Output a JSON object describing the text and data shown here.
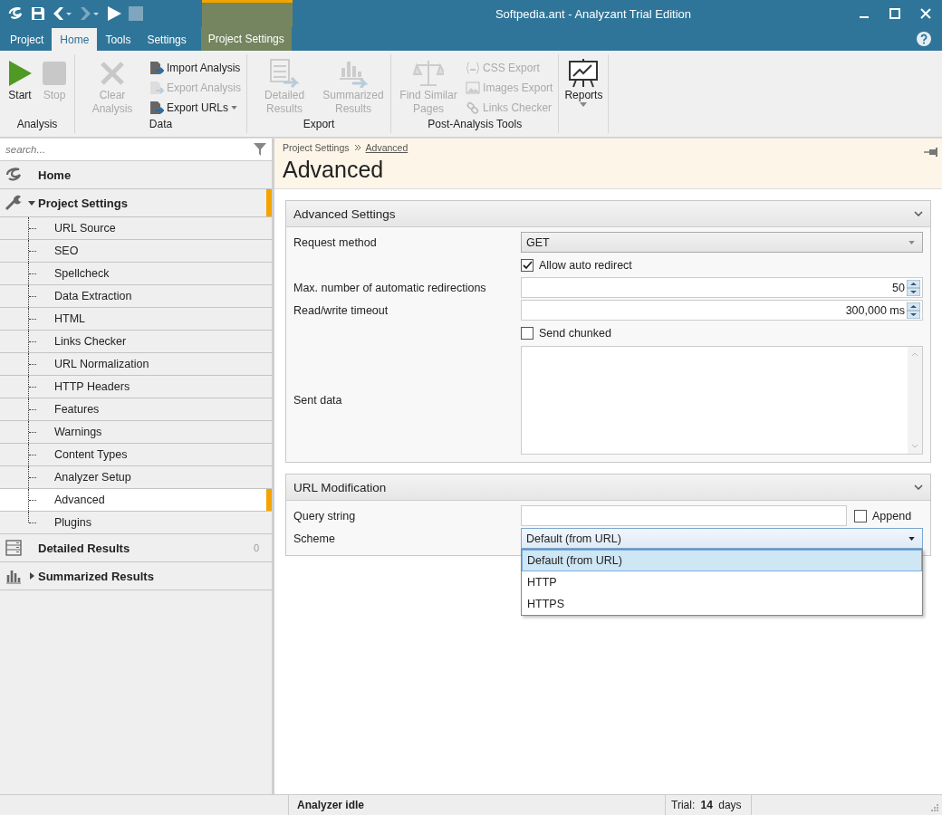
{
  "window": {
    "title": "Softpedia.ant - Analyzant Trial Edition"
  },
  "tabs": [
    {
      "label": "Project",
      "selected": false,
      "kind": "file"
    },
    {
      "label": "Home",
      "selected": true,
      "kind": "normal"
    },
    {
      "label": "Tools",
      "selected": false,
      "kind": "normal"
    },
    {
      "label": "Settings",
      "selected": false,
      "kind": "normal"
    },
    {
      "label": "Project Settings",
      "selected": false,
      "kind": "contextual"
    }
  ],
  "ribbon": {
    "groups": [
      {
        "label": "Analysis",
        "items": [
          {
            "label": "Start",
            "kind": "large",
            "disabled": false
          },
          {
            "label": "Stop",
            "kind": "large",
            "disabled": true
          }
        ]
      },
      {
        "label": "Data",
        "items": [
          {
            "label": "Clear Analysis",
            "kind": "large",
            "disabled": true
          },
          {
            "label": "Import Analysis",
            "kind": "small",
            "disabled": false
          },
          {
            "label": "Export Analysis",
            "kind": "small",
            "disabled": true
          },
          {
            "label": "Export URLs",
            "kind": "small",
            "disabled": false,
            "dropdown": true
          }
        ]
      },
      {
        "label": "Export",
        "items": [
          {
            "label": "Detailed Results",
            "kind": "large",
            "disabled": true
          },
          {
            "label": "Summarized Results",
            "kind": "large",
            "disabled": true
          }
        ]
      },
      {
        "label": "Post-Analysis Tools",
        "items": [
          {
            "label": "Find Similar Pages",
            "kind": "large",
            "disabled": true
          },
          {
            "label": "CSS Export",
            "kind": "small",
            "disabled": true
          },
          {
            "label": "Images Export",
            "kind": "small",
            "disabled": true
          },
          {
            "label": "Links Checker",
            "kind": "small",
            "disabled": true
          }
        ]
      },
      {
        "items": [
          {
            "label": "Reports",
            "kind": "large",
            "disabled": false,
            "dropdown": true
          }
        ]
      }
    ]
  },
  "sidebar": {
    "search": {
      "placeholder": "search..."
    },
    "items": [
      {
        "label": "Home",
        "selected": false
      },
      {
        "label": "Project Settings",
        "selected": false,
        "expanded": true,
        "active_path": true,
        "children": [
          {
            "label": "URL Source",
            "selected": false
          },
          {
            "label": "SEO",
            "selected": false
          },
          {
            "label": "Spellcheck",
            "selected": false
          },
          {
            "label": "Data Extraction",
            "selected": false
          },
          {
            "label": "HTML",
            "selected": false
          },
          {
            "label": "Links Checker",
            "selected": false
          },
          {
            "label": "URL Normalization",
            "selected": false
          },
          {
            "label": "HTTP Headers",
            "selected": false
          },
          {
            "label": "Features",
            "selected": false
          },
          {
            "label": "Warnings",
            "selected": false
          },
          {
            "label": "Content Types",
            "selected": false
          },
          {
            "label": "Analyzer Setup",
            "selected": false
          },
          {
            "label": "Advanced",
            "selected": true
          },
          {
            "label": "Plugins",
            "selected": false
          }
        ]
      },
      {
        "label": "Detailed Results",
        "selected": false,
        "count": "0"
      },
      {
        "label": "Summarized Results",
        "selected": false,
        "expanded": false
      }
    ]
  },
  "breadcrumb": [
    "Project Settings",
    "Advanced"
  ],
  "page_title": "Advanced",
  "sections": [
    {
      "title": "Advanced Settings",
      "rows": [
        {
          "kind": "select",
          "label": "Request method",
          "value": "GET",
          "open": false
        },
        {
          "kind": "checkbox",
          "label": "Allow auto redirect",
          "checked": true
        },
        {
          "kind": "spin",
          "label": "Max. number of automatic redirections",
          "value": "50"
        },
        {
          "kind": "spin",
          "label": "Read/write timeout",
          "value": "300,000 ms"
        },
        {
          "kind": "checkbox",
          "label": "Send chunked",
          "checked": false
        },
        {
          "kind": "textarea",
          "label": "Sent data"
        }
      ]
    },
    {
      "title": "URL Modification",
      "rows": [
        {
          "kind": "text_check",
          "label": "Query string",
          "check_label": "Append",
          "checked": false
        },
        {
          "kind": "select",
          "label": "Scheme",
          "value": "Default (from URL)",
          "open": true,
          "options": [
            {
              "label": "Default (from URL)",
              "selected": true
            },
            {
              "label": "HTTP",
              "selected": false
            },
            {
              "label": "HTTPS",
              "selected": false
            }
          ]
        }
      ]
    }
  ],
  "status_bar": [
    "Analyzer idle",
    "Trial: **14** days"
  ]
}
